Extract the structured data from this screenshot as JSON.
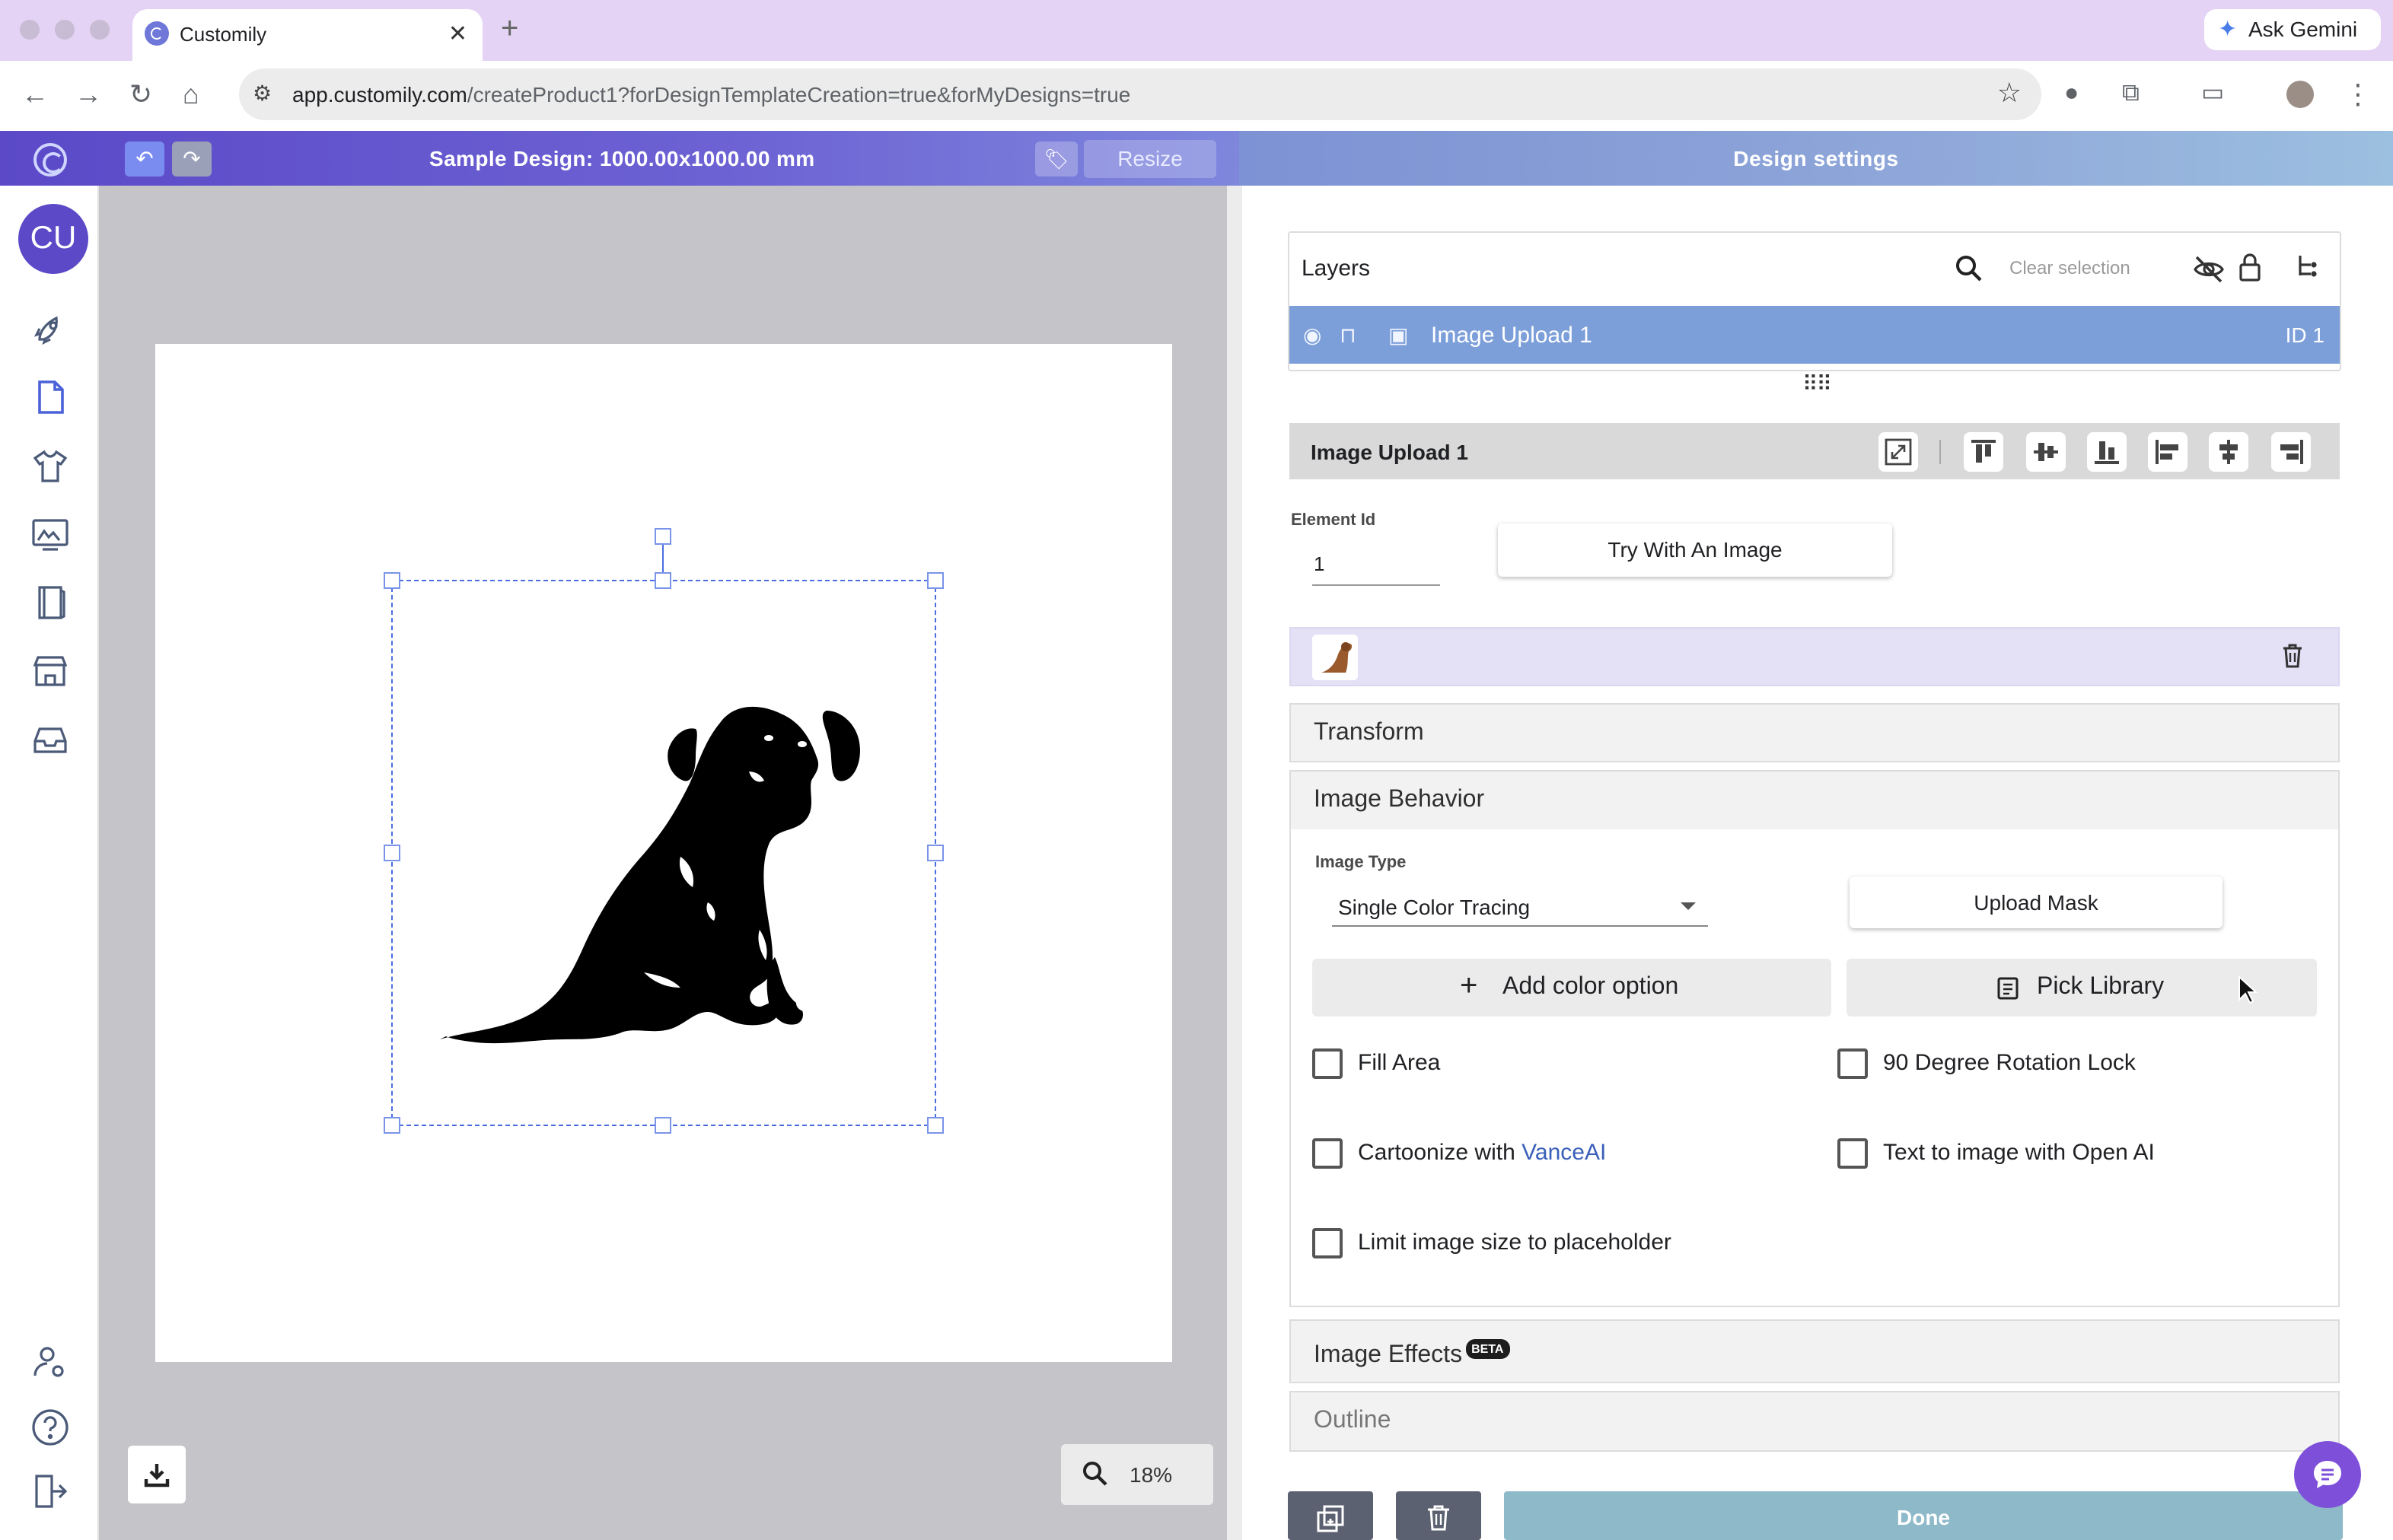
{
  "browser": {
    "tab_title": "Customily",
    "tab_close": "✕",
    "new_tab": "+",
    "ask_gemini": "Ask Gemini",
    "url_host": "app.customily.com",
    "url_path": "/createProduct1?forDesignTemplateCreation=true&forMyDesigns=true"
  },
  "header": {
    "design_title": "Sample Design: 1000.00x1000.00 mm",
    "resize_label": "Resize",
    "settings_title": "Design settings"
  },
  "sidebar": {
    "avatar_initials": "CU",
    "items": [
      "rocket-icon",
      "document-icon",
      "tshirt-icon",
      "image-gallery-icon",
      "notebook-icon",
      "store-icon",
      "inbox-icon"
    ],
    "bottom_items": [
      "user-settings-icon",
      "help-icon",
      "logout-icon"
    ]
  },
  "canvas": {
    "zoom": "18%",
    "image_alt": "Dog silhouette"
  },
  "layers": {
    "title": "Layers",
    "clear_selection": "Clear selection",
    "rows": [
      {
        "name": "Image Upload 1",
        "id_label": "ID 1"
      }
    ]
  },
  "element": {
    "name": "Image Upload 1",
    "element_id_label": "Element Id",
    "element_id_value": "1",
    "try_image_label": "Try With An Image"
  },
  "sections": {
    "transform": "Transform",
    "image_behavior": "Image Behavior",
    "image_effects": "Image Effects",
    "beta_badge": "BETA",
    "outline": "Outline"
  },
  "behavior": {
    "image_type_label": "Image Type",
    "image_type_value": "Single Color Tracing",
    "upload_mask": "Upload Mask",
    "add_color_option": "Add color option",
    "pick_library": "Pick Library",
    "checkboxes": {
      "fill_area": {
        "label": "Fill Area",
        "checked": false
      },
      "rotation_lock": {
        "label": "90 Degree Rotation Lock",
        "checked": false
      },
      "cartoonize_prefix": "Cartoonize with ",
      "cartoonize_link": "VanceAI",
      "cartoonize_checked": false,
      "text_to_image": {
        "label": "Text to image with Open AI",
        "checked": false
      },
      "limit_size": {
        "label": "Limit image size to placeholder",
        "checked": false
      }
    }
  },
  "footer": {
    "done_label": "Done"
  },
  "colors": {
    "brand_purple": "#5b49c7",
    "selection_blue": "#7c9fd9",
    "done_teal": "#8eb9c9",
    "chat_purple": "#7e4fd9"
  }
}
